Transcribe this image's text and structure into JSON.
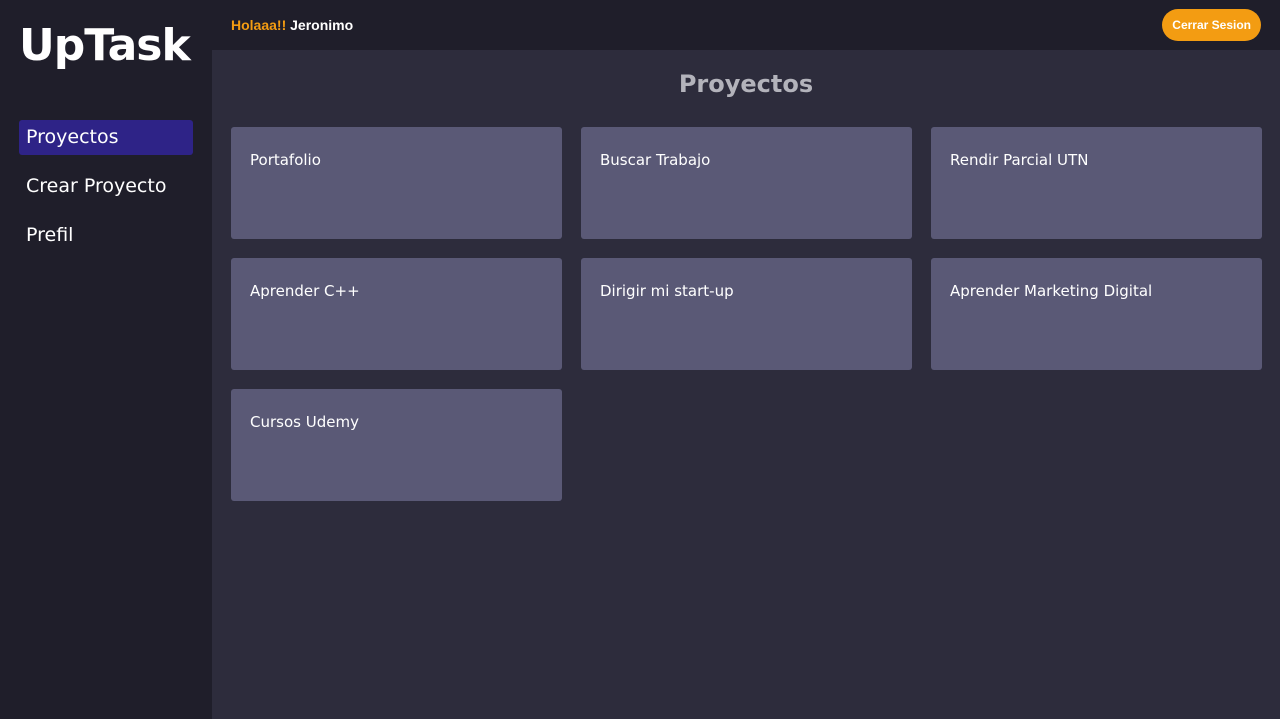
{
  "sidebar": {
    "brand": "UpTask",
    "items": [
      {
        "label": "Proyectos",
        "active": true
      },
      {
        "label": "Crear Proyecto",
        "active": false
      },
      {
        "label": "Prefil",
        "active": false
      }
    ]
  },
  "header": {
    "greeting": "Holaaa!!",
    "username": "Jeronimo",
    "logout_label": "Cerrar Sesion"
  },
  "main": {
    "title": "Proyectos",
    "projects": [
      {
        "name": "Portafolio"
      },
      {
        "name": "Buscar Trabajo"
      },
      {
        "name": "Rendir Parcial UTN"
      },
      {
        "name": "Aprender C++"
      },
      {
        "name": "Dirigir mi start-up"
      },
      {
        "name": "Aprender Marketing Digital"
      },
      {
        "name": "Cursos Udemy"
      }
    ]
  },
  "colors": {
    "accent": "#f39c12",
    "active_nav": "#2e2387",
    "card": "#5a5976",
    "background": "#2d2c3c",
    "sidebar": "#1f1e2a"
  }
}
